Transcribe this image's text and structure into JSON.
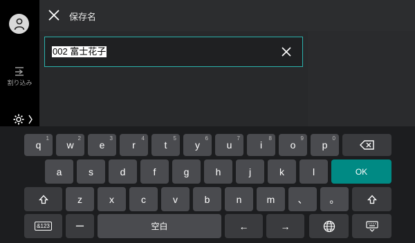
{
  "sidebar": {
    "interrupt_label": "割り込み"
  },
  "header": {
    "title": "保存名"
  },
  "field": {
    "value": "002 富士花子"
  },
  "keyboard": {
    "row1": [
      {
        "label": "q",
        "num": "1"
      },
      {
        "label": "w",
        "num": "2"
      },
      {
        "label": "e",
        "num": "3"
      },
      {
        "label": "r",
        "num": "4"
      },
      {
        "label": "t",
        "num": "5"
      },
      {
        "label": "y",
        "num": "6"
      },
      {
        "label": "u",
        "num": "7"
      },
      {
        "label": "i",
        "num": "8"
      },
      {
        "label": "o",
        "num": "9"
      },
      {
        "label": "p",
        "num": "0"
      }
    ],
    "row2": [
      "a",
      "s",
      "d",
      "f",
      "g",
      "h",
      "j",
      "k",
      "l"
    ],
    "ok_label": "OK",
    "row3": [
      "z",
      "x",
      "c",
      "v",
      "b",
      "n",
      "m",
      "、",
      "。"
    ],
    "mode_label": "&123",
    "dash_label": "ー",
    "space_label": "空白",
    "left_label": "←",
    "right_label": "→"
  },
  "colors": {
    "accent": "#008a84",
    "field_border": "#2bb3ad"
  }
}
